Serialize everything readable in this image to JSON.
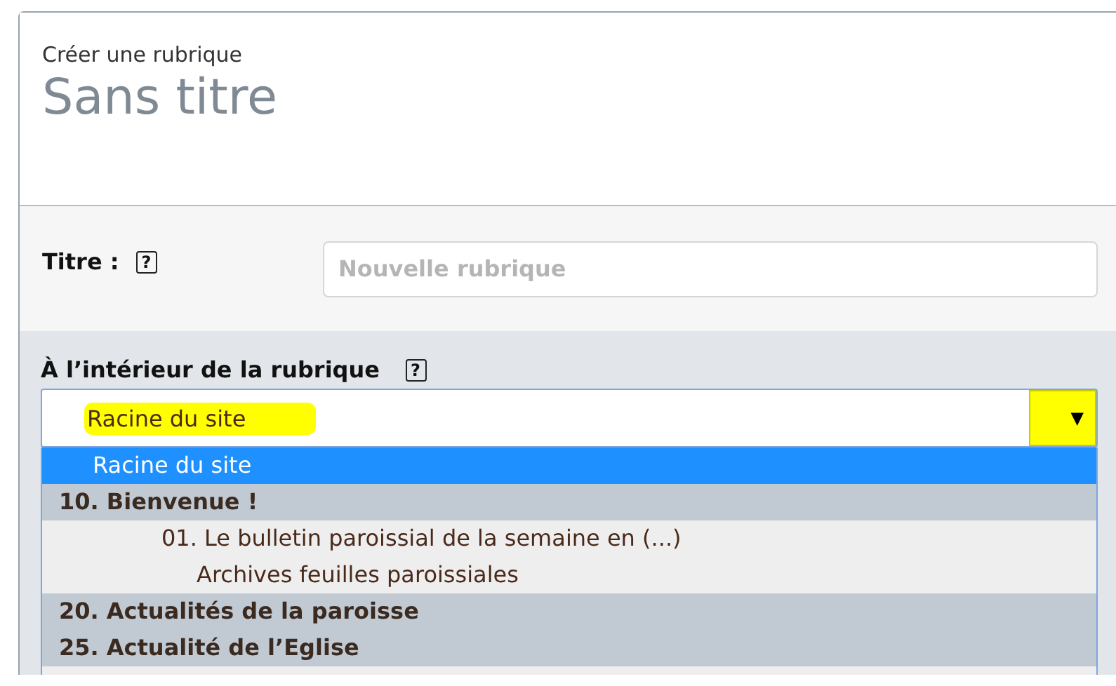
{
  "header": {
    "subtitle": "Créer une rubrique",
    "title": "Sans titre"
  },
  "title_field": {
    "label": "Titre :",
    "help": "?",
    "placeholder": "Nouvelle rubrique"
  },
  "parent_field": {
    "label": "À l’intérieur de la rubrique",
    "help": "?",
    "value": "Racine du site",
    "arrow": "▼",
    "options": [
      {
        "kind": "root",
        "label": "Racine du site",
        "selected": true
      },
      {
        "kind": "group",
        "label": "10. Bienvenue !",
        "selected": false,
        "children": [
          {
            "kind": "item",
            "label": "01. Le bulletin paroissial de la semaine en (...)",
            "selected": false,
            "children": [
              {
                "kind": "item",
                "label": "Archives feuilles paroissiales",
                "selected": false
              }
            ]
          }
        ]
      },
      {
        "kind": "group",
        "label": "20. Actualités de la paroisse",
        "selected": false
      },
      {
        "kind": "group",
        "label": "25. Actualité de l’Eglise",
        "selected": false
      }
    ]
  }
}
